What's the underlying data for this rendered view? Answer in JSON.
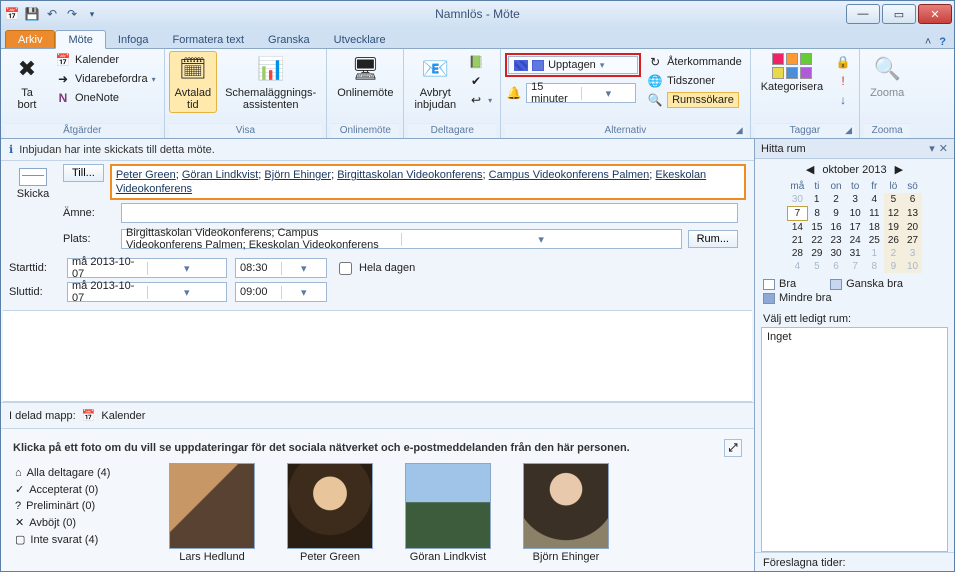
{
  "window": {
    "title": "Namnlös - Möte"
  },
  "tabs": {
    "file": "Arkiv",
    "items": [
      "Möte",
      "Infoga",
      "Formatera text",
      "Granska",
      "Utvecklare"
    ],
    "active": "Möte"
  },
  "ribbon": {
    "groups": {
      "atgarder": {
        "label": "Åtgärder",
        "delete": "Ta\nbort",
        "kalender": "Kalender",
        "vidarebefordra": "Vidarebefordra",
        "onenote": "OneNote"
      },
      "visa": {
        "label": "Visa",
        "avtalad": "Avtalad\ntid",
        "schema": "Schemaläggnings-\nassistenten"
      },
      "onlinemote": {
        "label": "Onlinemöte",
        "btn": "Onlinemöte"
      },
      "deltagare": {
        "label": "Deltagare",
        "avbryt": "Avbryt\ninbjudan"
      },
      "alternativ": {
        "label": "Alternativ",
        "upptagen": "Upptagen",
        "paminnelse": "15 minuter",
        "aterkommande": "Återkommande",
        "tidszoner": "Tidszoner",
        "rumssokare": "Rumssökare"
      },
      "taggar": {
        "label": "Taggar",
        "kategorisera": "Kategorisera"
      },
      "zooma": {
        "label": "Zooma",
        "btn": "Zooma"
      }
    }
  },
  "notice": "Inbjudan har inte skickats till detta möte.",
  "form": {
    "skicka": "Skicka",
    "till_btn": "Till...",
    "amne_label": "Ämne:",
    "amne_value": "",
    "plats_label": "Plats:",
    "plats_value": "Birgittaskolan Videokonferens; Campus Videokonferens Palmen; Ekeskolan Videokonferens",
    "rum_btn": "Rum...",
    "starttid_label": "Starttid:",
    "start_date": "må 2013-10-07",
    "start_time": "08:30",
    "sluttid_label": "Sluttid:",
    "end_date": "må 2013-10-07",
    "end_time": "09:00",
    "heladagen": "Hela dagen",
    "attendees": [
      "Peter Green",
      "Göran Lindkvist",
      "Björn Ehinger",
      "Birgittaskolan Videokonferens",
      "Campus Videokonferens Palmen",
      "Ekeskolan Videokonferens"
    ]
  },
  "shared": {
    "text": "I delad mapp:",
    "folder": "Kalender"
  },
  "social": {
    "header": "Klicka på ett foto om du vill se uppdateringar för det sociala nätverket och e-postmeddelanden från den här personen.",
    "lists": {
      "all": "Alla deltagare (4)",
      "accepted": "Accepterat (0)",
      "tentative": "Preliminärt (0)",
      "declined": "Avböjt (0)",
      "noresp": "Inte svarat (4)"
    },
    "people": [
      "Lars Hedlund",
      "Peter Green",
      "Göran Lindkvist",
      "Björn Ehinger"
    ]
  },
  "roomfinder": {
    "title": "Hitta rum",
    "month": "oktober 2013",
    "dow": [
      "må",
      "ti",
      "on",
      "to",
      "fr",
      "lö",
      "sö"
    ],
    "weeks": [
      [
        {
          "d": 30,
          "dim": true
        },
        {
          "d": 1
        },
        {
          "d": 2
        },
        {
          "d": 3
        },
        {
          "d": 4
        },
        {
          "d": 5,
          "wk": true
        },
        {
          "d": 6,
          "wk": true
        }
      ],
      [
        {
          "d": 7,
          "sel": true
        },
        {
          "d": 8
        },
        {
          "d": 9
        },
        {
          "d": 10
        },
        {
          "d": 11
        },
        {
          "d": 12,
          "wk": true,
          "hi": true
        },
        {
          "d": 13,
          "wk": true,
          "hi": true
        }
      ],
      [
        {
          "d": 14
        },
        {
          "d": 15
        },
        {
          "d": 16
        },
        {
          "d": 17
        },
        {
          "d": 18
        },
        {
          "d": 19,
          "wk": true
        },
        {
          "d": 20,
          "wk": true
        }
      ],
      [
        {
          "d": 21
        },
        {
          "d": 22
        },
        {
          "d": 23
        },
        {
          "d": 24
        },
        {
          "d": 25
        },
        {
          "d": 26,
          "wk": true
        },
        {
          "d": 27,
          "wk": true
        }
      ],
      [
        {
          "d": 28
        },
        {
          "d": 29
        },
        {
          "d": 30
        },
        {
          "d": 31
        },
        {
          "d": 1,
          "dim": true
        },
        {
          "d": 2,
          "dim": true,
          "wk": true
        },
        {
          "d": 3,
          "dim": true,
          "wk": true
        }
      ],
      [
        {
          "d": 4,
          "dim": true
        },
        {
          "d": 5,
          "dim": true
        },
        {
          "d": 6,
          "dim": true
        },
        {
          "d": 7,
          "dim": true
        },
        {
          "d": 8,
          "dim": true
        },
        {
          "d": 9,
          "dim": true,
          "wk": true
        },
        {
          "d": 10,
          "dim": true,
          "wk": true
        }
      ]
    ],
    "legend": {
      "bra": "Bra",
      "ganska": "Ganska bra",
      "mindre": "Mindre bra"
    },
    "choose_label": "Välj ett ledigt rum:",
    "none": "Inget",
    "suggested": "Föreslagna tider:"
  }
}
